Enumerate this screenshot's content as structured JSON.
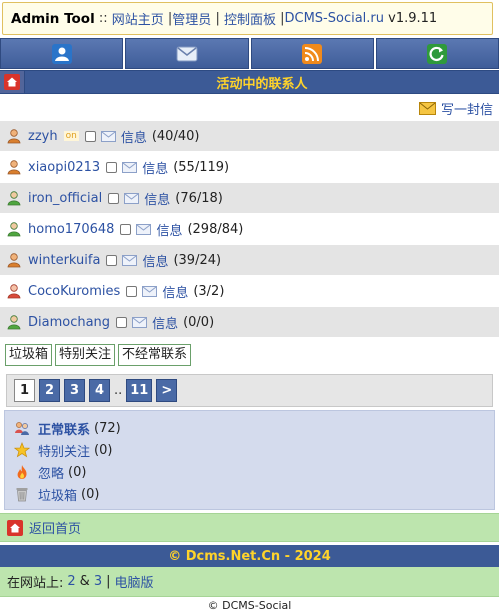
{
  "admin_bar": {
    "title": "Admin Tool",
    "sep_main": "::",
    "links": [
      {
        "label": "网站主页"
      },
      {
        "label": "管理员"
      },
      {
        "label": "控制面板"
      },
      {
        "label": "DCMS-Social.ru"
      }
    ],
    "version": "v1.9.11"
  },
  "icon_nav": [
    {
      "icon": "user-icon"
    },
    {
      "icon": "mail-icon"
    },
    {
      "icon": "rss-icon"
    },
    {
      "icon": "refresh-icon"
    }
  ],
  "page_title": "活动中的联系人",
  "write_message": "写一封信",
  "contacts": [
    {
      "name": "zzyh",
      "online": "on",
      "msg_label": "信息",
      "count": "(40/40)",
      "avatar": "orange"
    },
    {
      "name": "xiaopi0213",
      "online": "",
      "msg_label": "信息",
      "count": "(55/119)",
      "avatar": "orange"
    },
    {
      "name": "iron_official",
      "online": "",
      "msg_label": "信息",
      "count": "(76/18)",
      "avatar": "green"
    },
    {
      "name": "homo170648",
      "online": "",
      "msg_label": "信息",
      "count": "(298/84)",
      "avatar": "green"
    },
    {
      "name": "winterkuifa",
      "online": "",
      "msg_label": "信息",
      "count": "(39/24)",
      "avatar": "orange"
    },
    {
      "name": "CocoKuromies",
      "online": "",
      "msg_label": "信息",
      "count": "(3/2)",
      "avatar": "red"
    },
    {
      "name": "Diamochang",
      "online": "",
      "msg_label": "信息",
      "count": "(0/0)",
      "avatar": "green"
    }
  ],
  "filters": [
    {
      "label": "垃圾箱"
    },
    {
      "label": "特别关注"
    },
    {
      "label": "不经常联系"
    }
  ],
  "pagination": {
    "pages": [
      "1",
      "2",
      "3",
      "4"
    ],
    "current": "1",
    "ellipsis": "..",
    "last": "11",
    "next": ">"
  },
  "categories": [
    {
      "label": "正常联系",
      "count": "(72)",
      "icon": "people-icon",
      "bold": true
    },
    {
      "label": "特别关注",
      "count": "(0)",
      "icon": "star-icon",
      "bold": false
    },
    {
      "label": "忽略",
      "count": "(0)",
      "icon": "fire-icon",
      "bold": false
    },
    {
      "label": "垃圾箱",
      "count": "(0)",
      "icon": "trash-icon",
      "bold": false
    }
  ],
  "back_home": "返回首页",
  "footer_title": "© Dcms.Net.Cn - 2024",
  "online": {
    "label": "在网站上:",
    "a": "2",
    "amp": "&",
    "b": "3",
    "bar": "|",
    "pc": "电脑版"
  },
  "copyright": "© DCMS-Social",
  "colors": {
    "nav_blue": "#3c5a96",
    "title_yellow": "#ffd32a",
    "link_blue": "#2d52a3",
    "green_bar": "#bde5ae",
    "category_bg": "#d4dbed"
  }
}
